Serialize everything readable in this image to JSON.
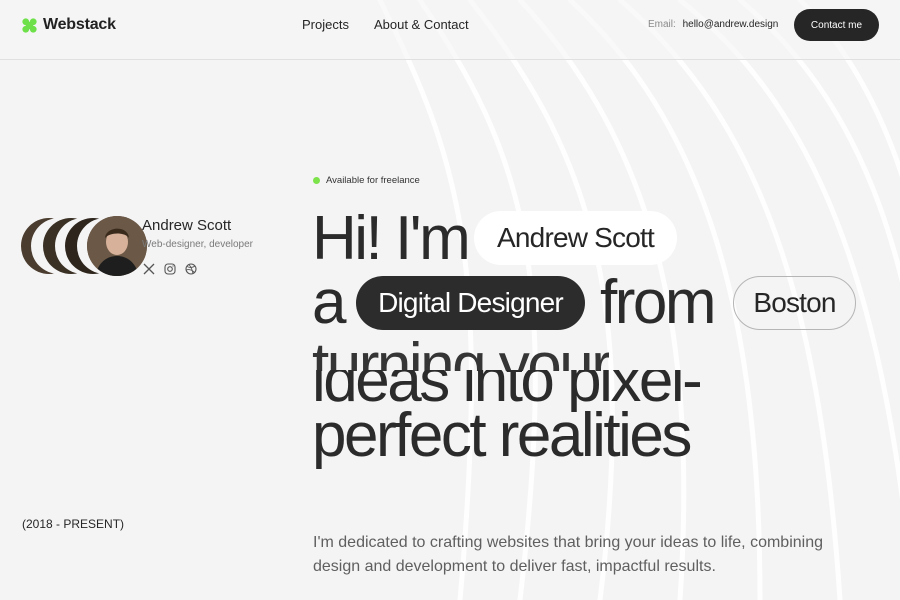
{
  "header": {
    "logo_text": "Webstack",
    "nav": [
      {
        "label": "Projects"
      },
      {
        "label": "About & Contact"
      }
    ],
    "email_label": "Email:",
    "email_value": "hello@andrew.design",
    "contact_button": "Contact me"
  },
  "profile": {
    "name": "Andrew Scott",
    "role": "Web-designer, developer",
    "socials": [
      "x-icon",
      "instagram-icon",
      "dribbble-icon"
    ]
  },
  "hero": {
    "badge": "Available for freelance",
    "line1": "Hi! I'm",
    "name_pill": "Andrew Scott",
    "line2_prefix": "a",
    "role_pill": "Digital Designer",
    "line2_suffix": "from",
    "city_pill": "Boston",
    "line3": "turning your",
    "line4": "ideas into pixel-",
    "line5": "perfect realities",
    "description": "I'm dedicated to crafting websites that bring your ideas to life, combining design and development to deliver fast, impactful results."
  },
  "period": "(2018 - PRESENT)",
  "colors": {
    "accent": "#7ce34a",
    "dark": "#262626",
    "background": "#f4f4f4"
  }
}
